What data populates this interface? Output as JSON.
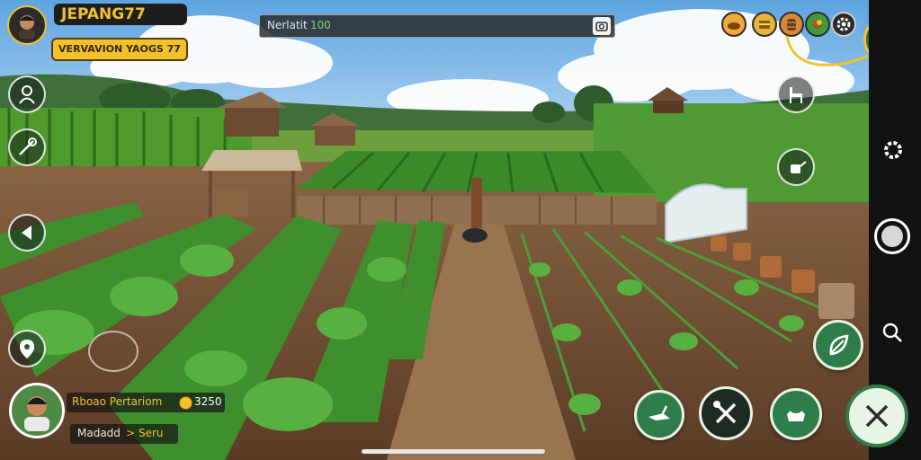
{
  "player": {
    "name": "JEPANG77",
    "subtitle": "VERVAVION YAOGS 77"
  },
  "search": {
    "text": "Nerlatit",
    "value": "100"
  },
  "chat": {
    "name": "Rboao Pertariom",
    "coins": "3250",
    "message": "Madadd",
    "arrow": ">",
    "recipient": "Seru"
  },
  "colors": {
    "accent_yellow": "#f2c22d",
    "button_green": "#2f7d4a",
    "sky": "#7fb8e8",
    "soil": "#6b4a31",
    "crop": "#3f8f2f"
  },
  "icons": {
    "top_resources": [
      "bread-icon",
      "gold-chest-icon",
      "wood-barrel-icon",
      "vegetable-bowl-icon",
      "settings-gear-icon"
    ],
    "left_tools": [
      "farmer-icon",
      "tool-icon",
      "back-arrow-icon",
      "map-marker-icon"
    ],
    "right_bar": [
      "settings-gear-icon",
      "record-button-icon",
      "search-icon"
    ],
    "bottom_actions": [
      "plow-icon",
      "shovel-rake-icon",
      "seed-bag-icon",
      "cancel-icon"
    ],
    "right_actions": [
      "chair-icon",
      "watering-can-icon",
      "harvest-leaf-icon"
    ]
  }
}
